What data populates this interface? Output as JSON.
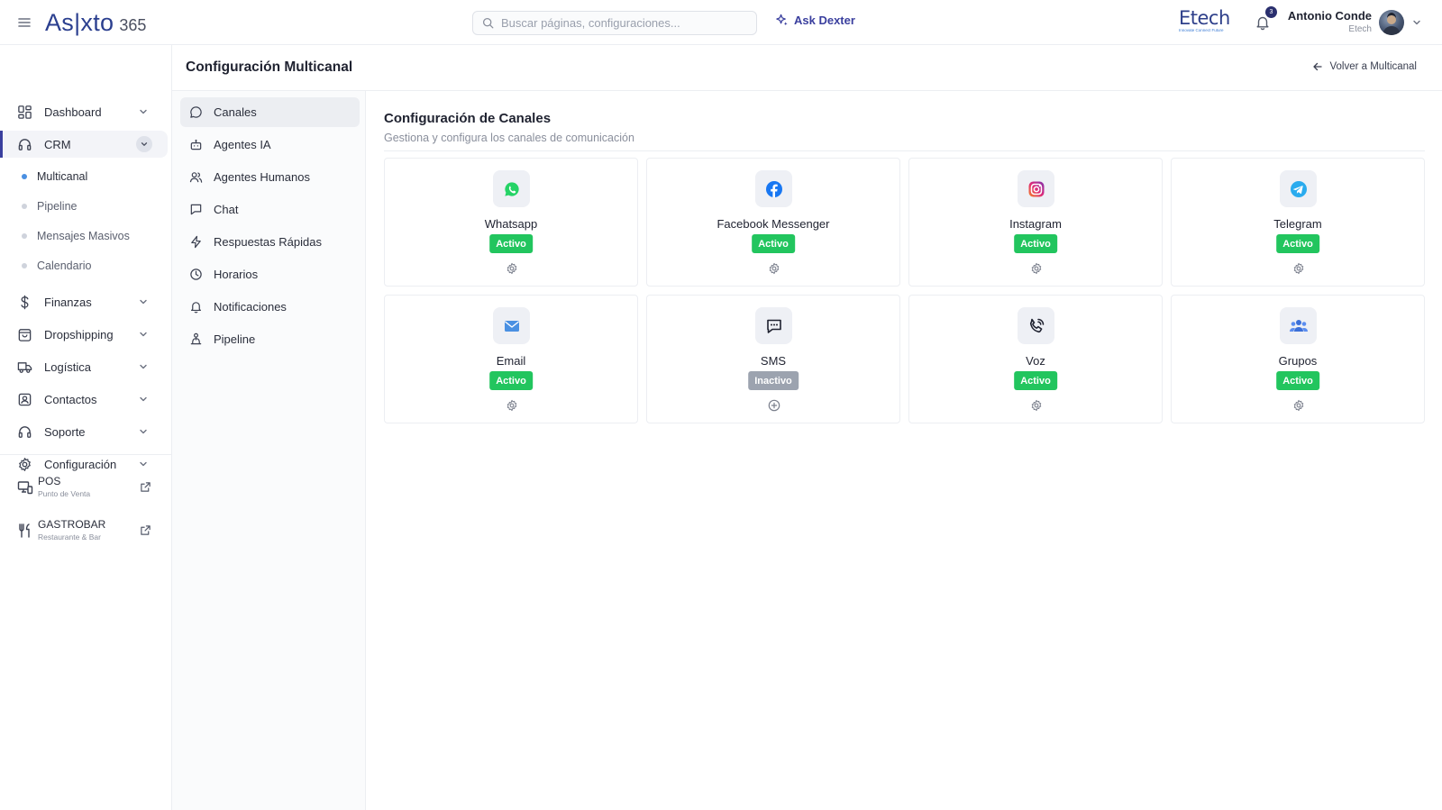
{
  "app": {
    "logo_main": "As|xto",
    "logo_num": "365",
    "ask_label": "Ask Dexter",
    "search_placeholder": "Buscar páginas, configuraciones...",
    "brand_name": "Etech",
    "brand_tagline": "Innovate Connect Future",
    "notifications": "3",
    "user_name": "Antonio Conde",
    "user_org": "Etech"
  },
  "sidebar": {
    "items": [
      {
        "label": "Dashboard",
        "icon": "dashboard-icon"
      },
      {
        "label": "CRM",
        "icon": "headset-icon"
      },
      {
        "label": "Finanzas",
        "icon": "dollar-icon"
      },
      {
        "label": "Dropshipping",
        "icon": "bag-icon"
      },
      {
        "label": "Logística",
        "icon": "truck-icon"
      },
      {
        "label": "Contactos",
        "icon": "contacts-icon"
      },
      {
        "label": "Soporte",
        "icon": "headset-icon"
      },
      {
        "label": "Configuración",
        "icon": "gear-icon"
      }
    ],
    "crm_sub": [
      "Multicanal",
      "Pipeline",
      "Mensajes Masivos",
      "Calendario"
    ],
    "external": [
      {
        "title": "POS",
        "subtitle": "Punto de Venta"
      },
      {
        "title": "GASTROBAR",
        "subtitle": "Restaurante & Bar"
      }
    ]
  },
  "header": {
    "title": "Configuración Multicanal",
    "back_label": "Volver a Multicanal"
  },
  "subnav": [
    "Canales",
    "Agentes IA",
    "Agentes Humanos",
    "Chat",
    "Respuestas Rápidas",
    "Horarios",
    "Notificaciones",
    "Pipeline"
  ],
  "section": {
    "title": "Configuración de Canales",
    "subtitle": "Gestiona y configura los canales de comunicación"
  },
  "channels": [
    {
      "name": "Whatsapp",
      "status": "Activo",
      "icon": "whatsapp-icon",
      "color": "#25D366"
    },
    {
      "name": "Facebook Messenger",
      "status": "Activo",
      "icon": "facebook-icon",
      "color": "#1877F2"
    },
    {
      "name": "Instagram",
      "status": "Activo",
      "icon": "instagram-icon",
      "color": "#E1306C"
    },
    {
      "name": "Telegram",
      "status": "Activo",
      "icon": "telegram-icon",
      "color": "#2AABEE"
    },
    {
      "name": "Email",
      "status": "Activo",
      "icon": "email-icon",
      "color": "#4A90E2"
    },
    {
      "name": "SMS",
      "status": "Inactivo",
      "icon": "sms-icon",
      "color": "#1f2230"
    },
    {
      "name": "Voz",
      "status": "Activo",
      "icon": "phone-icon",
      "color": "#1f2230"
    },
    {
      "name": "Grupos",
      "status": "Activo",
      "icon": "group-icon",
      "color": "#3B6FD8"
    }
  ]
}
